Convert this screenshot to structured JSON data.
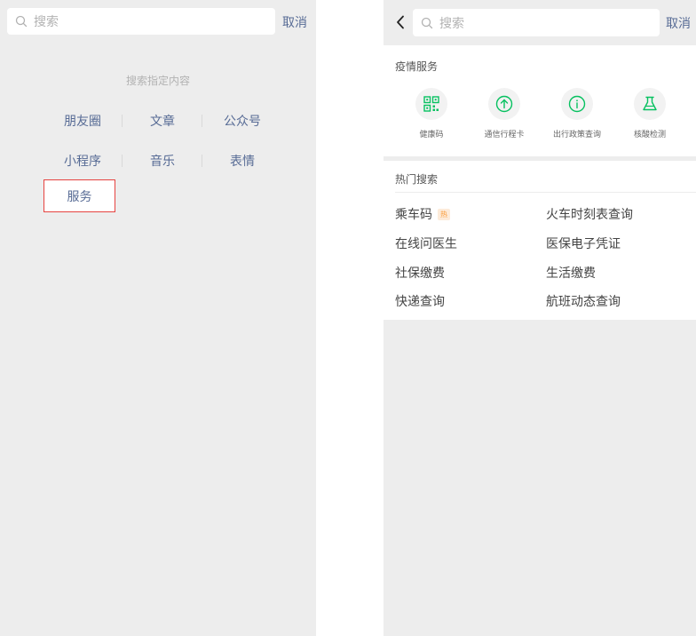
{
  "left": {
    "search": {
      "placeholder": "搜索"
    },
    "cancel_label": "取消",
    "specify_label": "搜索指定内容",
    "categories_row1": [
      "朋友圈",
      "文章",
      "公众号"
    ],
    "categories_row2": [
      "小程序",
      "音乐",
      "表情"
    ],
    "service_label": "服务",
    "highlight_color": "#e64340"
  },
  "right": {
    "search": {
      "placeholder": "搜索"
    },
    "cancel_label": "取消",
    "epidemic": {
      "title": "疫情服务",
      "items": [
        {
          "label": "健康码",
          "icon": "qr-code-icon"
        },
        {
          "label": "通信行程卡",
          "icon": "arrow-up-circle-icon"
        },
        {
          "label": "出行政策查询",
          "icon": "info-circle-icon"
        },
        {
          "label": "核酸检测",
          "icon": "flask-icon"
        }
      ]
    },
    "hot": {
      "title": "热门搜索",
      "badge": "热",
      "items": [
        [
          "乘车码",
          "火车时刻表查询"
        ],
        [
          "在线问医生",
          "医保电子凭证"
        ],
        [
          "社保缴费",
          "生活缴费"
        ],
        [
          "快递查询",
          "航班动态查询"
        ]
      ]
    }
  },
  "colors": {
    "accent_green": "#07c160",
    "link_blue": "#576b95",
    "background": "#ededed"
  }
}
